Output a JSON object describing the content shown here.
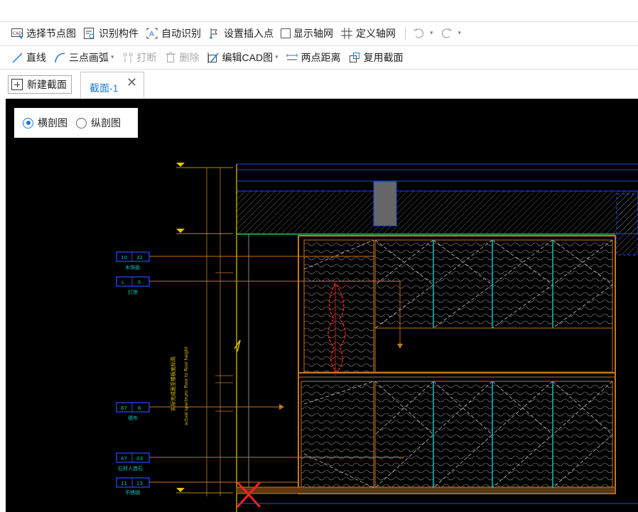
{
  "toolbar1": {
    "select_node_view": "选择节点图",
    "identify_component": "识别构件",
    "auto_identify": "自动识别",
    "set_insert_point": "设置插入点",
    "show_axis_grid": "显示轴网",
    "define_axis_grid": "定义轴网"
  },
  "toolbar2": {
    "line": "直线",
    "three_point_arc": "三点画弧",
    "break": "打断",
    "delete": "删除",
    "edit_cad": "编辑CAD图",
    "two_point_distance": "两点距离",
    "reuse_section": "复用截面"
  },
  "tabs": {
    "new_section": "新建截面",
    "active_tab": "截面-1"
  },
  "view_panel": {
    "horizontal": "横剖图",
    "vertical": "纵剖图",
    "selected": "horizontal"
  },
  "drawing": {
    "tags": [
      {
        "left": "10",
        "right": "32",
        "caption": "木饰面"
      },
      {
        "left": "L",
        "right": "5",
        "caption": "灯带"
      },
      {
        "left": "87",
        "right": "6",
        "caption": "墙布"
      },
      {
        "left": "47",
        "right": "03",
        "caption": "石材人造石"
      },
      {
        "left": "11",
        "right": "13",
        "caption": "不锈钢"
      }
    ],
    "vertical_note_1": "实际完成面至楼板底标高",
    "vertical_note_2": "actual spectrum: floor to floor height",
    "colors": {
      "accent": "#1a7bd8",
      "cad_orange": "#c8761f",
      "cad_blue": "#2244ff",
      "cad_cyan": "#00c4c4",
      "cad_red": "#ff2020",
      "cad_yellow": "#e6c400"
    }
  }
}
